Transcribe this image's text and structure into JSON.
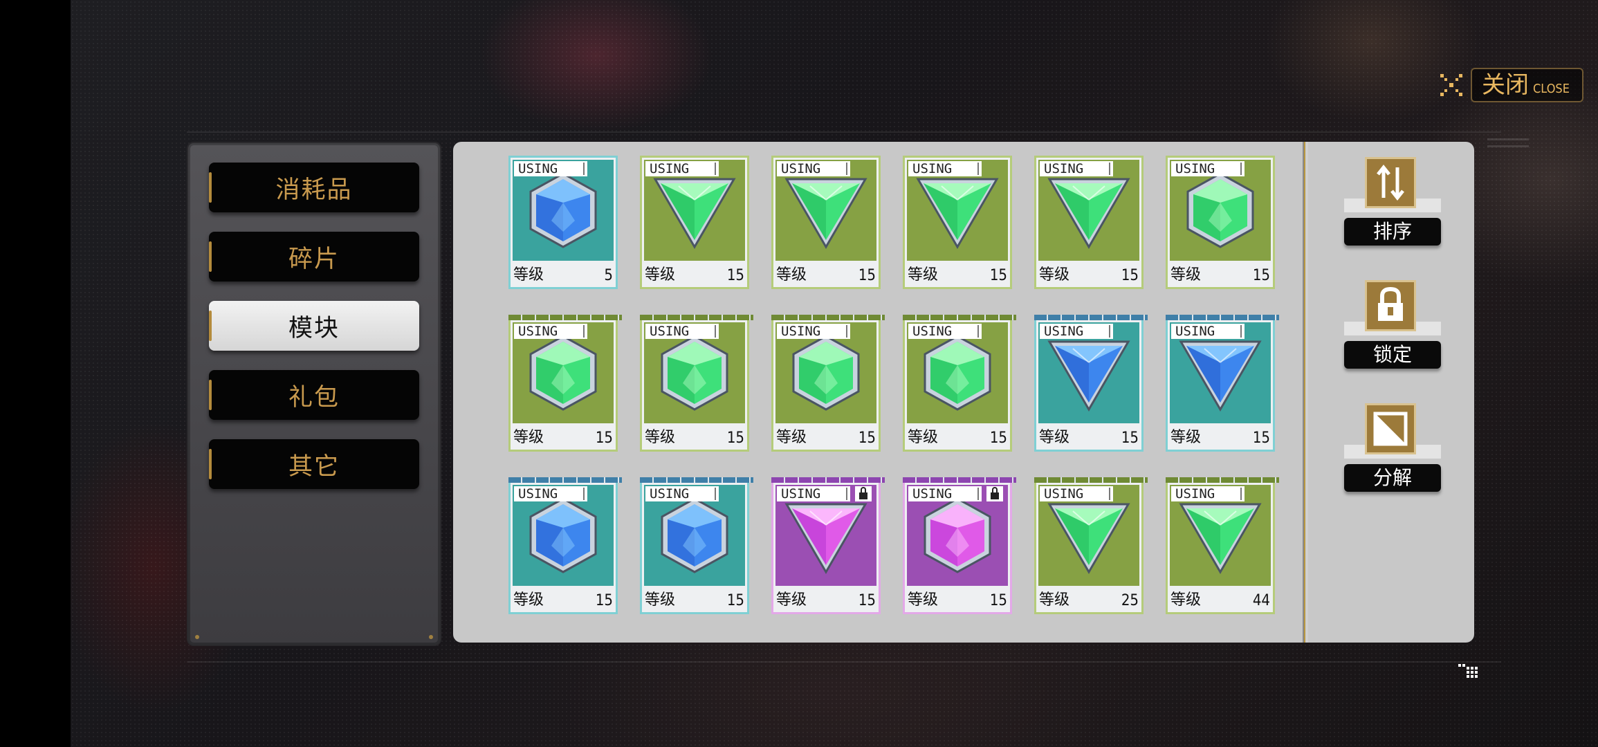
{
  "close": {
    "label_cn": "关闭",
    "label_en": "CLOSE"
  },
  "categories": [
    {
      "label": "消耗品",
      "active": false
    },
    {
      "label": "碎片",
      "active": false
    },
    {
      "label": "模块",
      "active": true
    },
    {
      "label": "礼包",
      "active": false
    },
    {
      "label": "其它",
      "active": false
    }
  ],
  "grid": {
    "level_label": "等级",
    "using_label": "USING",
    "rows": [
      [
        {
          "color": "teal",
          "gem": "blue",
          "shape": "hex",
          "level": "5",
          "locked": false
        },
        {
          "color": "olive",
          "gem": "green",
          "shape": "tri",
          "level": "15",
          "locked": false
        },
        {
          "color": "olive",
          "gem": "green",
          "shape": "tri",
          "level": "15",
          "locked": false
        },
        {
          "color": "olive",
          "gem": "green",
          "shape": "tri",
          "level": "15",
          "locked": false
        },
        {
          "color": "olive",
          "gem": "green",
          "shape": "tri",
          "level": "15",
          "locked": false
        },
        {
          "color": "olive",
          "gem": "green",
          "shape": "hex",
          "level": "15",
          "locked": false
        }
      ],
      [
        {
          "color": "olive",
          "gem": "green",
          "shape": "hex",
          "level": "15",
          "locked": false
        },
        {
          "color": "olive",
          "gem": "green",
          "shape": "hex",
          "level": "15",
          "locked": false
        },
        {
          "color": "olive",
          "gem": "green",
          "shape": "hex",
          "level": "15",
          "locked": false
        },
        {
          "color": "olive",
          "gem": "green",
          "shape": "hex",
          "level": "15",
          "locked": false
        },
        {
          "color": "teal",
          "gem": "blue",
          "shape": "tri",
          "level": "15",
          "locked": false
        },
        {
          "color": "teal",
          "gem": "blue",
          "shape": "tri",
          "level": "15",
          "locked": false
        }
      ],
      [
        {
          "color": "teal",
          "gem": "blue",
          "shape": "hex",
          "level": "15",
          "locked": false
        },
        {
          "color": "teal",
          "gem": "blue",
          "shape": "hex",
          "level": "15",
          "locked": false
        },
        {
          "color": "purple",
          "gem": "pink",
          "shape": "tri",
          "level": "15",
          "locked": true
        },
        {
          "color": "purple",
          "gem": "pink",
          "shape": "hex",
          "level": "15",
          "locked": true
        },
        {
          "color": "olive",
          "gem": "green",
          "shape": "tri",
          "level": "25",
          "locked": false
        },
        {
          "color": "olive",
          "gem": "green",
          "shape": "tri",
          "level": "44",
          "locked": false
        }
      ]
    ]
  },
  "actions": [
    {
      "label": "排序",
      "icon": "sort-icon"
    },
    {
      "label": "锁定",
      "icon": "lock-icon"
    },
    {
      "label": "分解",
      "icon": "decompose-icon"
    }
  ],
  "colors": {
    "teal_bg": "#3aa39e",
    "olive_bg": "#86a144",
    "purple_bg": "#9b4fb3",
    "accent_gold": "#e8b760",
    "panel_gray": "#c8c8c8"
  }
}
